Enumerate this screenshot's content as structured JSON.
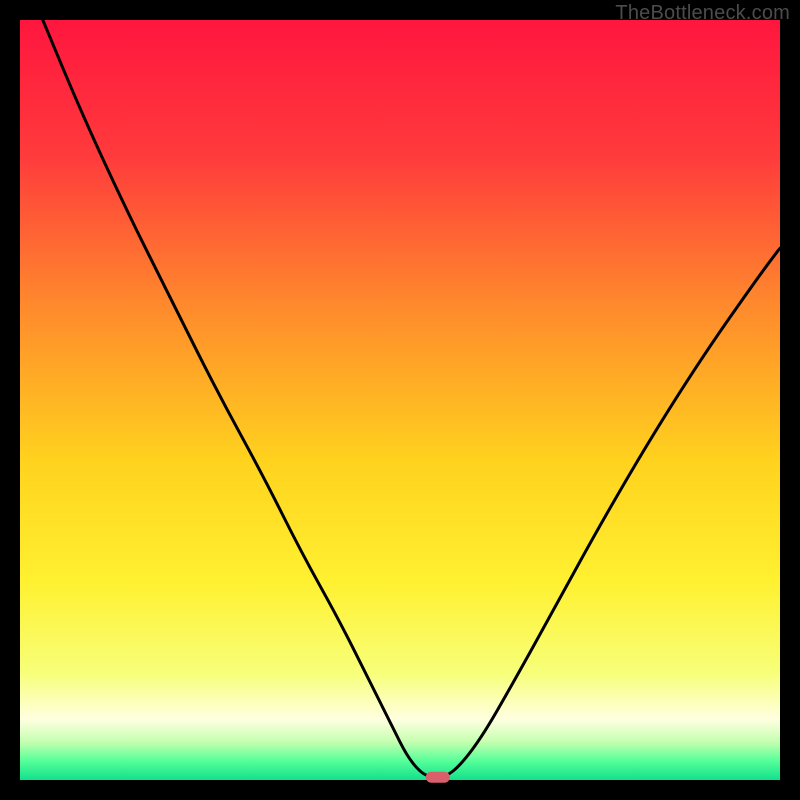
{
  "attribution": "TheBottleneck.com",
  "chart_data": {
    "type": "line",
    "title": "",
    "xlabel": "",
    "ylabel": "",
    "xlim": [
      0,
      100
    ],
    "ylim": [
      0,
      100
    ],
    "series": [
      {
        "name": "bottleneck-curve",
        "color": "#000000",
        "width": 3,
        "x": [
          3,
          8,
          14,
          20,
          26,
          32,
          37,
          42,
          46,
          49,
          51,
          53,
          54.5,
          56,
          58,
          61,
          65,
          70,
          76,
          83,
          90,
          97,
          100
        ],
        "y": [
          100,
          88,
          75,
          63,
          51,
          40,
          30,
          21,
          13,
          7,
          3,
          0.7,
          0.4,
          0.4,
          2,
          6,
          13,
          22,
          33,
          45,
          56,
          66,
          70
        ]
      }
    ],
    "marker": {
      "x": 55,
      "y": 0.4,
      "width_pct": 3.2,
      "height_pct": 1.4,
      "color": "#d9606a"
    },
    "gradient_stops": [
      {
        "pct": 0,
        "color": "#ff163e"
      },
      {
        "pct": 18,
        "color": "#ff3b3c"
      },
      {
        "pct": 38,
        "color": "#ff8b2c"
      },
      {
        "pct": 58,
        "color": "#ffd21e"
      },
      {
        "pct": 74,
        "color": "#fff131"
      },
      {
        "pct": 86,
        "color": "#f7ff7a"
      },
      {
        "pct": 92,
        "color": "#ffffe0"
      },
      {
        "pct": 95,
        "color": "#c4ffb0"
      },
      {
        "pct": 97.5,
        "color": "#55ff99"
      },
      {
        "pct": 100,
        "color": "#12e08c"
      }
    ]
  }
}
